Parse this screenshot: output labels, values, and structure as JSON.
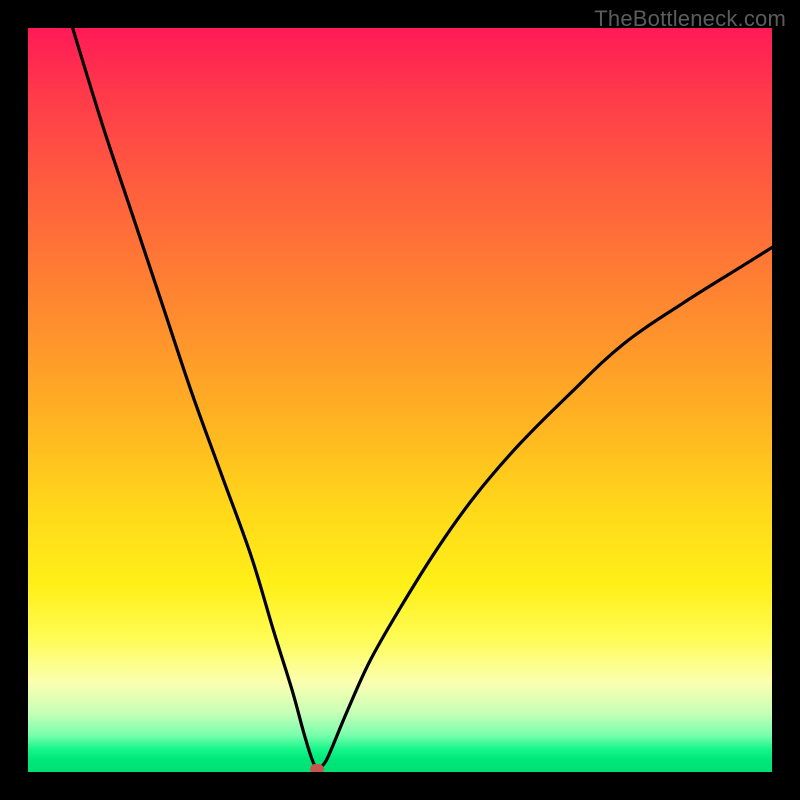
{
  "watermark": {
    "text": "TheBottleneck.com"
  },
  "chart_data": {
    "type": "line",
    "title": "",
    "xlabel": "",
    "ylabel": "",
    "xlim": [
      0,
      100
    ],
    "ylim": [
      0,
      100
    ],
    "grid": false,
    "legend": false,
    "background": "rainbow-vertical-gradient (red top → green bottom)",
    "series": [
      {
        "name": "bottleneck-curve",
        "color": "#000000",
        "x": [
          6,
          10,
          14,
          18,
          22,
          26,
          30,
          33,
          35.5,
          37,
          38,
          38.6,
          39.2,
          40,
          41,
          43,
          46,
          50,
          55,
          60,
          66,
          73,
          80,
          88,
          96,
          100
        ],
        "y": [
          100,
          87,
          75,
          63,
          51,
          40,
          29,
          19,
          11,
          5.5,
          2.2,
          0.8,
          0.6,
          1.4,
          3.6,
          8.4,
          15,
          22,
          30,
          37,
          44,
          51,
          57.5,
          63,
          68,
          70.5
        ]
      }
    ],
    "marker": {
      "x": 38.8,
      "y": 0.35,
      "color": "#c6574e",
      "shape": "rounded-rect"
    }
  }
}
